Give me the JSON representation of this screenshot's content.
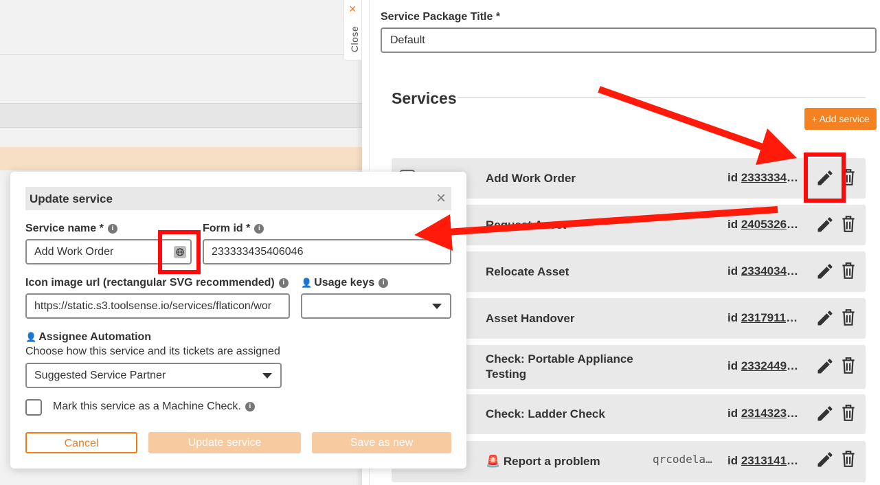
{
  "panel": {
    "close_label": "Close",
    "close_icon": "×",
    "package_title_label": "Service Package Title *",
    "package_title_value": "Default",
    "services_heading": "Services",
    "add_service_label": "+ Add service"
  },
  "services": [
    {
      "name": "Add Work Order",
      "extra": "",
      "id_prefix": "id",
      "id": "23333343..."
    },
    {
      "name": "Request Asset",
      "extra": "",
      "id_prefix": "id",
      "id": "24053260..."
    },
    {
      "name": "Relocate Asset",
      "extra": "",
      "id_prefix": "id",
      "id": "23340345..."
    },
    {
      "name": "Asset Handover",
      "extra": "",
      "id_prefix": "id",
      "id": "23179117..."
    },
    {
      "name": "Check: Portable Appliance Testing",
      "extra": "",
      "id_prefix": "id",
      "id": "23324499..."
    },
    {
      "name": "Check: Ladder Check",
      "extra": "",
      "id_prefix": "id",
      "id": "23143235..."
    },
    {
      "name": "🚨 Report a problem",
      "extra": "qrcodela…",
      "id_prefix": "id",
      "id": "23131418..."
    }
  ],
  "modal": {
    "title": "Update service",
    "close_icon": "×",
    "service_name_label": "Service name *",
    "service_name_value": "Add Work Order",
    "form_id_label": "Form id *",
    "form_id_value": "233333435406046",
    "icon_url_label": "Icon image url (rectangular SVG recommended)",
    "icon_url_value": "https://static.s3.toolsense.io/services/flaticon/wor",
    "usage_keys_label": "Usage keys",
    "usage_keys_value": "",
    "assignee_label": "Assignee Automation",
    "assignee_hint": "Choose how this service and its tickets are assigned",
    "assignee_value": "Suggested Service Partner",
    "machine_check_label": "Mark this service as a Machine Check.",
    "info_icon": "i",
    "cancel_label": "Cancel",
    "update_label": "Update service",
    "save_new_label": "Save as new"
  },
  "colors": {
    "accent": "#f58220",
    "annotation": "#ff0a0a",
    "row_bg": "#e9e9e9"
  },
  "icons": [
    "close-icon",
    "pencil-icon",
    "trash-icon",
    "info-icon",
    "globe-icon",
    "user-icon",
    "chevron-down-icon",
    "checkbox-icon"
  ]
}
